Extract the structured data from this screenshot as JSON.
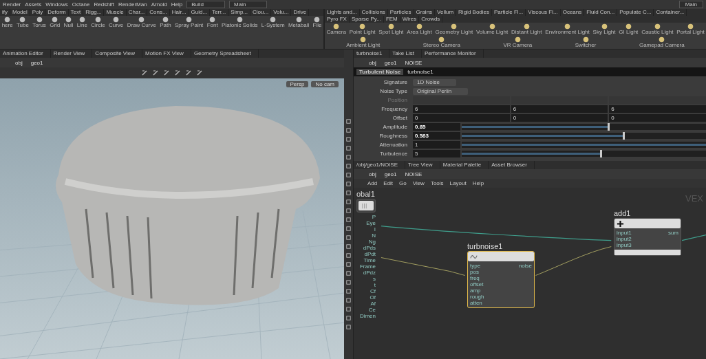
{
  "menu_bar": {
    "items": [
      "Render",
      "Assets",
      "Windows",
      "Octane",
      "Redshift",
      "RenderMan",
      "Arnold",
      "Help"
    ],
    "desktop": "Build",
    "main_desk": "Main",
    "right_desk": "Main"
  },
  "left_shelf": {
    "tabs": [
      "ify",
      "Model",
      "Poly",
      "Deform",
      "Text",
      "Rigg...",
      "Muscle",
      "Char...",
      "Cons...",
      "Hair...",
      "Guid...",
      "Terr...",
      "Simp...",
      "Clou...",
      "Volu...",
      "Drive"
    ],
    "tools": [
      "here",
      "Tube",
      "Torus",
      "Grid",
      "Null",
      "Line",
      "Circle",
      "Curve",
      "Draw Curve",
      "Path",
      "Spray Paint",
      "Font",
      "Platonic Solids",
      "L-System",
      "Metaball",
      "File"
    ]
  },
  "right_shelf": {
    "tabs": [
      "Lights and...",
      "Collisions",
      "Particles",
      "Grains",
      "Vellum",
      "Rigid Bodies",
      "Particle Fl...",
      "Viscous Fl...",
      "Oceans",
      "Fluid Con...",
      "Populate C...",
      "Container...",
      "Pyro FX",
      "Sparse Py...",
      "FEM",
      "Wires",
      "Crowds"
    ],
    "tools": [
      "Camera",
      "Point Light",
      "Spot Light",
      "Area Light",
      "Geometry Light",
      "Volume Light",
      "Distant Light",
      "Environment Light",
      "Sky Light",
      "GI Light",
      "Caustic Light",
      "Portal Light",
      "Ambient Light",
      "Stereo Camera",
      "VR Camera",
      "Switcher",
      "Gamepad Camera"
    ]
  },
  "viewer_pane": {
    "tabs": [
      "Animation Editor",
      "Render View",
      "Composite View",
      "Motion FX View",
      "Geometry Spreadsheet"
    ],
    "path": [
      "obj",
      "geo1"
    ],
    "view_buttons": [
      "Persp",
      "No cam"
    ]
  },
  "param_pane": {
    "tabs": [
      "turbnoise1",
      "Take List",
      "Performance Monitor"
    ],
    "path": [
      "obj",
      "geo1",
      "NOISE"
    ],
    "node_type": "Turbulent Noise",
    "node_name": "turbnoise1",
    "params": [
      {
        "label": "Signature",
        "kind": "menu",
        "value": "1D Noise",
        "disabled": false
      },
      {
        "label": "Noise Type",
        "kind": "menu",
        "value": "Original Perlin",
        "disabled": false
      },
      {
        "label": "Position",
        "kind": "vector",
        "disabled": true
      },
      {
        "label": "Frequency",
        "kind": "vector",
        "values": [
          "6",
          "6",
          "6"
        ],
        "disabled": false
      },
      {
        "label": "Offset",
        "kind": "vector",
        "values": [
          "0",
          "0",
          "0"
        ],
        "disabled": false
      },
      {
        "label": "Amplitude",
        "kind": "slider",
        "value": "0.85",
        "level": 0.58,
        "bold": true,
        "disabled": false
      },
      {
        "label": "Roughness",
        "kind": "slider",
        "value": "0.583",
        "level": 0.64,
        "bold": true,
        "disabled": false
      },
      {
        "label": "Attenuation",
        "kind": "slider",
        "value": "1",
        "level": 1,
        "bold": false,
        "disabled": false
      },
      {
        "label": "Turbulence",
        "kind": "slider",
        "value": "5",
        "level": 0.55,
        "bold": false,
        "disabled": false
      }
    ]
  },
  "network_pane": {
    "tabs": [
      "/obj/geo1/NOISE",
      "Tree View",
      "Material Palette",
      "Asset Browser"
    ],
    "path": [
      "obj",
      "geo1",
      "NOISE"
    ],
    "menu": [
      "Add",
      "Edit",
      "Go",
      "View",
      "Tools",
      "Layout",
      "Help"
    ],
    "context_label": "VEX",
    "nodes": [
      {
        "name": "obal1",
        "kind": "globals",
        "selected": false,
        "outputs": [
          "P",
          "Eye",
          "I",
          "N",
          "Ng",
          "dPds",
          "dPdt",
          "Time",
          "Frame",
          "dPdz",
          "s",
          "t",
          "Cf",
          "Of",
          "Af",
          "Ce",
          "Dimen"
        ]
      },
      {
        "name": "add1",
        "kind": "add",
        "selected": false,
        "inputs": [
          "input1",
          "input2",
          "input3"
        ],
        "outputs": [
          "sum"
        ]
      },
      {
        "name": "turbnoise1",
        "kind": "noise",
        "selected": true,
        "inputs": [
          "type",
          "pos",
          "freq",
          "offset",
          "amp",
          "rough",
          "atten"
        ],
        "outputs": [
          "noise"
        ]
      }
    ]
  }
}
